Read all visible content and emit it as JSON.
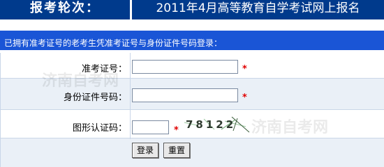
{
  "header": {
    "round_label": "报考轮次：",
    "round_value": "2011年4月高等教育自学考试网上报名"
  },
  "notice": {
    "text": "已拥有准考证号的老考生凭准考证号与身份证件号码登录："
  },
  "form": {
    "admission_label": "准考证号：",
    "admission_value": "",
    "id_label": "身份证件号码：",
    "id_value": "",
    "captcha_label": "图形认证码：",
    "captcha_value": "",
    "required_mark": "*",
    "captcha_text": "78122"
  },
  "buttons": {
    "login_label": "登录",
    "reset_label": "重置"
  },
  "watermark": {
    "text": "济南自考网"
  },
  "colors": {
    "header_bg": "#003a8c",
    "notice_bg": "#1a55d6",
    "row_alt_bg": "#eaf0f7",
    "required": "#e00000"
  }
}
